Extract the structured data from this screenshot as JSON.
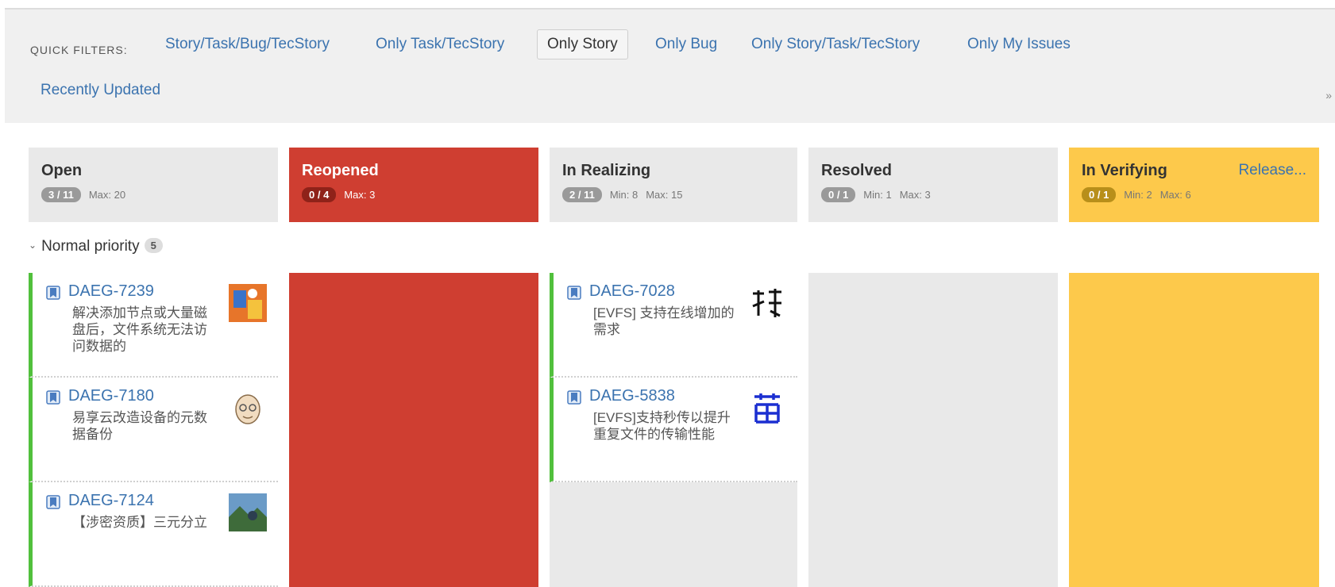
{
  "quick_filters": {
    "label": "QUICK FILTERS:",
    "items": [
      {
        "label": "Story/Task/Bug/TecStory",
        "active": false
      },
      {
        "label": "Only Task/TecStory",
        "active": false
      },
      {
        "label": "Only Story",
        "active": true
      },
      {
        "label": "Only Bug",
        "active": false
      },
      {
        "label": "Only Story/Task/TecStory",
        "active": false
      },
      {
        "label": "Only My Issues",
        "active": false
      },
      {
        "label": "Recently Updated",
        "active": false
      }
    ]
  },
  "columns": [
    {
      "name": "Open",
      "count": "3 / 11",
      "min": "",
      "max": "Max: 20",
      "color": "#e9e9e9"
    },
    {
      "name": "Reopened",
      "count": "0 / 4",
      "min": "",
      "max": "Max: 3",
      "color": "#cf3e31"
    },
    {
      "name": "In Realizing",
      "count": "2 / 11",
      "min": "Min: 8",
      "max": "Max: 15",
      "color": "#e9e9e9"
    },
    {
      "name": "Resolved",
      "count": "0 / 1",
      "min": "Min: 1",
      "max": "Max: 3",
      "color": "#e9e9e9"
    },
    {
      "name": "In Verifying",
      "count": "0 / 1",
      "min": "Min: 2",
      "max": "Max: 6",
      "color": "#fdc94b",
      "extra_link": "Release..."
    }
  ],
  "swimlane": {
    "label": "Normal priority",
    "count": "5"
  },
  "cards": {
    "open": [
      {
        "key": "DAEG-7239",
        "summary": "解决添加节点或大量磁盘后，文件系统无法访问数据的",
        "avatar": "photo-avatar"
      },
      {
        "key": "DAEG-7180",
        "summary": "易享云改造设备的元数据备份",
        "avatar": "cartoon-face-avatar"
      },
      {
        "key": "DAEG-7124",
        "summary": "【涉密资质】三元分立",
        "avatar": "landscape-avatar"
      }
    ],
    "in_realizing": [
      {
        "key": "DAEG-7028",
        "summary": "[EVFS] 支持在线增加的需求",
        "avatar": "calligraphy-avatar"
      },
      {
        "key": "DAEG-5838",
        "summary": "[EVFS]支持秒传以提升重复文件的传输性能",
        "avatar": "blue-character-avatar"
      }
    ]
  },
  "colors": {
    "accent_link": "#3b73af",
    "reopened": "#cf3e31",
    "verifying": "#fdc94b",
    "card_priority_bar": "#51c03c"
  }
}
